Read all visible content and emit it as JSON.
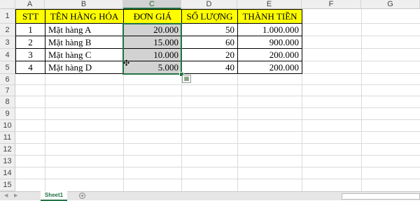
{
  "columns": [
    "A",
    "B",
    "C",
    "D",
    "E",
    "F",
    "G"
  ],
  "rows": [
    "1",
    "2",
    "3",
    "4",
    "5",
    "6",
    "7",
    "8",
    "9",
    "10",
    "11",
    "12",
    "13",
    "14",
    "15"
  ],
  "table": {
    "headers": [
      "STT",
      "TÊN HÀNG HÓA",
      "ĐƠN GIÁ",
      "SỐ LƯỢNG",
      "THÀNH TIỀN"
    ],
    "data": [
      [
        "1",
        "Mặt hàng A",
        "20.000",
        "50",
        "1.000.000"
      ],
      [
        "2",
        "Mặt hàng B",
        "15.000",
        "60",
        "900.000"
      ],
      [
        "3",
        "Mặt hàng C",
        "10.000",
        "20",
        "200.000"
      ],
      [
        "4",
        "Mặt hàng D",
        "5.000",
        "40",
        "200.000"
      ]
    ]
  },
  "selection": {
    "column": "C",
    "range": "C2:C5"
  },
  "sheet_tabs": [
    {
      "label": "Sheet1",
      "active": true
    }
  ],
  "add_sheet_symbol": "+",
  "nav_arrows": [
    "◀",
    "▶"
  ],
  "colors": {
    "header_fill": "#ffff00",
    "selection_fill": "#d2d2d2",
    "selection_border": "#217346"
  },
  "icons": {
    "quick_analysis": "quick-analysis-icon",
    "cursor": "fill-cross-cursor-icon"
  }
}
